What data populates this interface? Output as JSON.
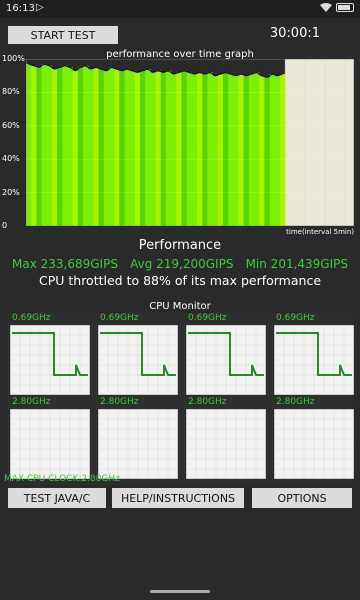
{
  "status_bar": {
    "time": "16:13",
    "play_icon": "play-icon",
    "wifi_icon": "wifi-icon",
    "battery_icon": "battery-icon",
    "battery_level": 0.85
  },
  "header": {
    "start_label": "START TEST",
    "timer": "30:00:1"
  },
  "graph": {
    "title": "performance over time graph",
    "y_labels": [
      "100%",
      "80%",
      "60%",
      "40%",
      "20%",
      "0"
    ],
    "x_label": "time(interval 5min)",
    "colors": {
      "fill_primary": "#7cf000",
      "fill_light": "#a6f500",
      "fill_dark": "#59d400",
      "idle": "#ece8d7",
      "line": "#111111"
    }
  },
  "chart_data": {
    "type": "area",
    "title": "performance over time graph",
    "xlabel": "time(interval 5min)",
    "ylabel": "",
    "ylim": [
      0,
      100
    ],
    "yticks": [
      "100%",
      "80%",
      "60%",
      "40%",
      "20%",
      "0"
    ],
    "elapsed_fraction": 0.79,
    "series": [
      {
        "values": [
          97,
          96,
          95,
          97,
          96,
          94,
          95,
          96,
          95,
          93,
          95,
          96,
          94,
          95,
          94,
          93,
          95,
          94,
          93,
          94,
          93,
          92,
          93,
          94,
          92,
          93,
          92,
          93,
          91,
          92,
          93,
          92,
          91,
          92,
          91,
          92,
          90,
          91,
          92,
          91,
          90,
          91,
          90,
          91,
          92,
          90,
          89,
          91,
          90,
          91
        ]
      }
    ]
  },
  "performance": {
    "title": "Performance",
    "max": "Max 233,689GIPS",
    "avg": "Avg 219,200GIPS",
    "min": "Min 201,439GIPS",
    "throttle": "CPU throttled to 88% of its max performance"
  },
  "cpu_monitor": {
    "title": "CPU Monitor",
    "colors": {
      "line": "#2a8a2a",
      "bg": "#f2f2f2",
      "grid": "#cfd8cf",
      "label": "#3ccc3c"
    },
    "cores": [
      {
        "label": "0.69GHz"
      },
      {
        "label": "0.69GHz"
      },
      {
        "label": "0.69GHz"
      },
      {
        "label": "0.69GHz"
      },
      {
        "label": "2.80GHz"
      },
      {
        "label": "2.80GHz"
      },
      {
        "label": "2.80GHz"
      },
      {
        "label": "2.80GHz"
      }
    ],
    "max_clock": "MAX CPU CLOCK:2.80GHz"
  },
  "buttons": {
    "test_java": "TEST JAVA/C",
    "help": "HELP/INSTRUCTIONS",
    "options": "OPTIONS"
  }
}
